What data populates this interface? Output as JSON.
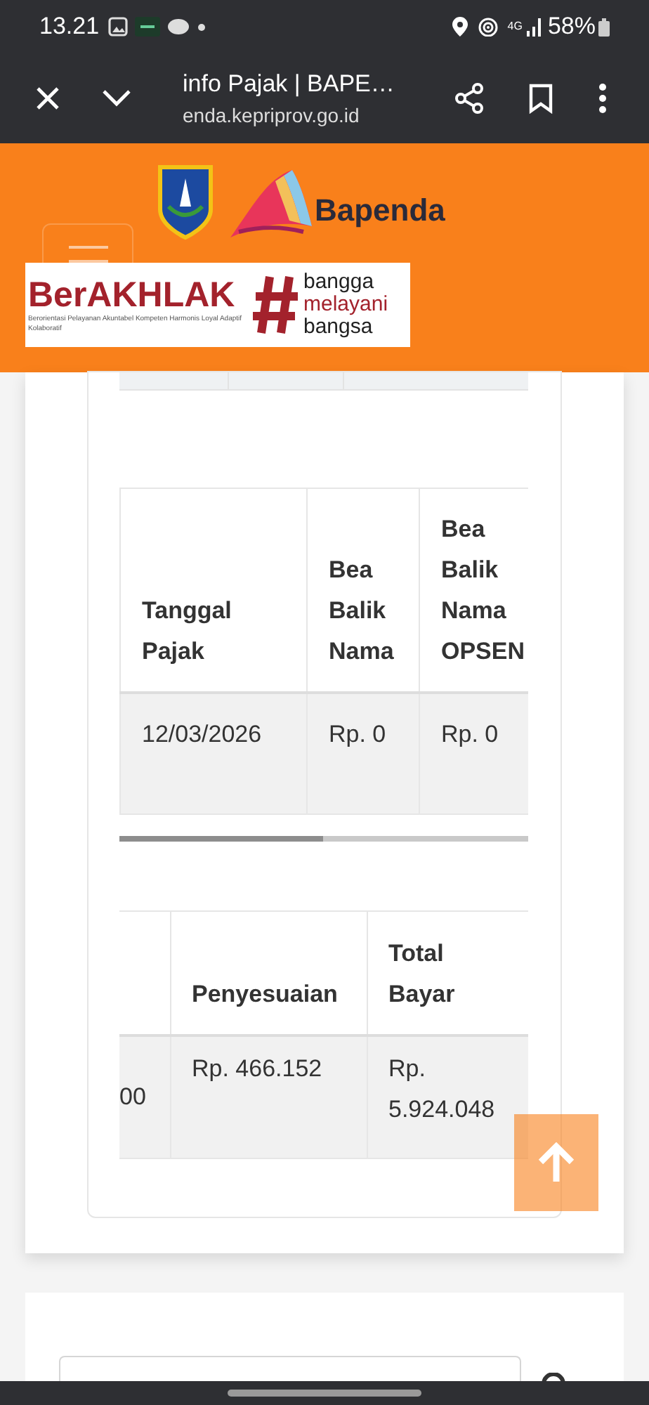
{
  "status_bar": {
    "time": "13.21",
    "network": "4G",
    "battery": "58%"
  },
  "browser": {
    "title": "info Pajak | BAPE…",
    "url": "enda.kepriprov.go.id"
  },
  "header": {
    "logo_text": "Bapenda",
    "banner": {
      "title": "BerAKHLAK",
      "subtitle": "Berorientasi Pelayanan Akuntabel Kompeten Harmonis Loyal Adaptif Kolaboratif",
      "tagline": [
        "bangga",
        "melayani",
        "bangsa"
      ]
    }
  },
  "tables": [
    {
      "columns": [
        "Tanggal Pajak",
        "Bea Balik Nama",
        "Bea Balik Nama OPSEN"
      ],
      "rows": [
        [
          "12/03/2026",
          "Rp. 0",
          "Rp. 0"
        ]
      ]
    },
    {
      "cut_column_cell": "00",
      "columns": [
        "Penyesuaian",
        "Total Bayar"
      ],
      "rows": [
        [
          "Rp. 466.152",
          "Rp. 5.924.048"
        ]
      ]
    }
  ]
}
